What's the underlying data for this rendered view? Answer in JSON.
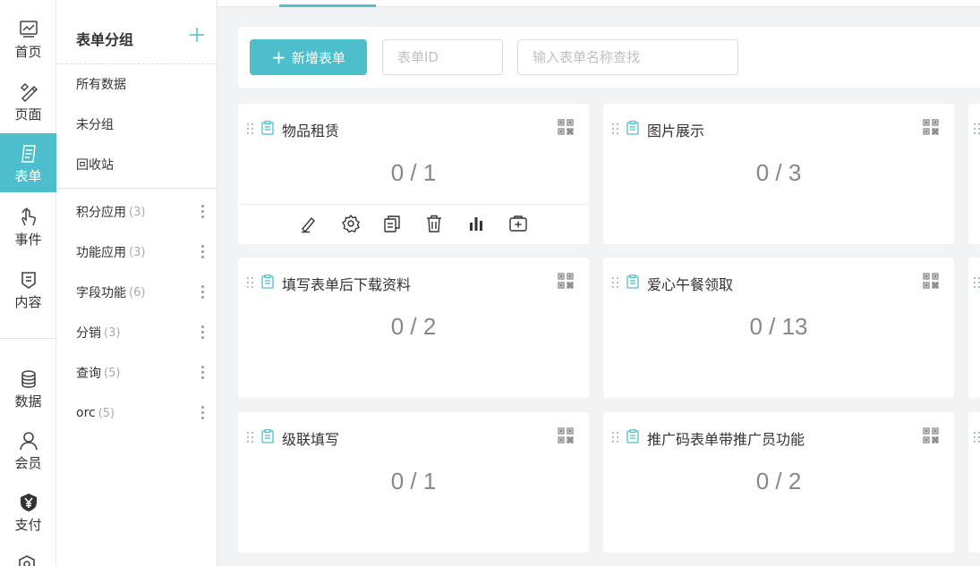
{
  "nav": {
    "items": [
      {
        "label": "首页",
        "icon": "chart-line-icon"
      },
      {
        "label": "页面",
        "icon": "edit-tools-icon"
      },
      {
        "label": "表单",
        "icon": "form-icon"
      },
      {
        "label": "事件",
        "icon": "touch-icon"
      },
      {
        "label": "内容",
        "icon": "document-icon"
      },
      {
        "label": "数据",
        "icon": "database-icon"
      },
      {
        "label": "会员",
        "icon": "user-icon"
      },
      {
        "label": "支付",
        "icon": "yen-icon"
      }
    ],
    "active": "表单"
  },
  "groups": {
    "title": "表单分组",
    "fixed": [
      {
        "label": "所有数据"
      },
      {
        "label": "未分组"
      },
      {
        "label": "回收站"
      }
    ],
    "custom": [
      {
        "label": "积分应用",
        "count": "(3)"
      },
      {
        "label": "功能应用",
        "count": "(3)"
      },
      {
        "label": "字段功能",
        "count": "(6)"
      },
      {
        "label": "分销",
        "count": "(3)"
      },
      {
        "label": "查询",
        "count": "(5)"
      },
      {
        "label": "orc",
        "count": "(5)"
      }
    ]
  },
  "toolbar": {
    "new_label": "新增表单",
    "id_placeholder": "表单ID",
    "name_placeholder": "输入表单名称查找"
  },
  "cards": [
    {
      "title": "物品租赁",
      "stat": "0 / 1"
    },
    {
      "title": "图片展示",
      "stat": "0 / 3"
    },
    {
      "title": "填写表单后下载资料",
      "stat": "0 / 2"
    },
    {
      "title": "爱心午餐领取",
      "stat": "0 / 13"
    },
    {
      "title": "级联填写",
      "stat": "0 / 1"
    },
    {
      "title": "推广码表单带推广员功能",
      "stat": "0 / 2"
    }
  ],
  "card_actions": [
    "edit-icon",
    "settings-icon",
    "copy-icon",
    "delete-icon",
    "stats-icon",
    "add-icon"
  ],
  "colors": {
    "accent": "#4dbfcc",
    "background": "#f2f3f5"
  }
}
